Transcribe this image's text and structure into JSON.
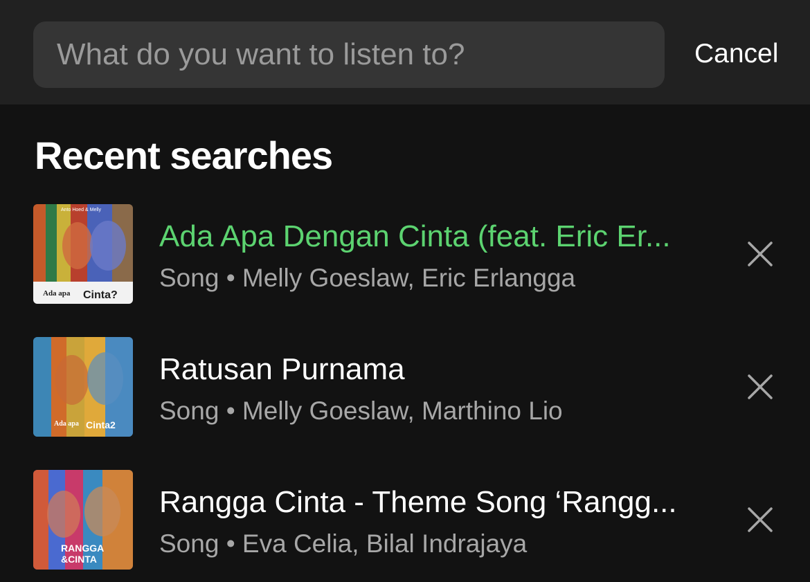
{
  "search": {
    "placeholder": "What do you want to listen to?",
    "value": "",
    "cancel_label": "Cancel"
  },
  "recent": {
    "heading": "Recent searches",
    "items": [
      {
        "title": "Ada Apa Dengan Cinta (feat. Eric Er...",
        "subtitle": "Song • Melly Goeslaw, Eric Erlangga",
        "active": true,
        "artwork_text": "Ada apa dengan Cinta?",
        "remove_icon": "close-icon"
      },
      {
        "title": "Ratusan Purnama",
        "subtitle": "Song • Melly Goeslaw, Marthino Lio",
        "active": false,
        "artwork_text": "Ada apa dengan Cinta 2",
        "remove_icon": "close-icon"
      },
      {
        "title": "Rangga Cinta - Theme Song ‘Rangg...",
        "subtitle": "Song • Eva Celia, Bilal Indrajaya",
        "active": false,
        "artwork_text": "RANGGA & CINTA",
        "remove_icon": "close-icon"
      }
    ]
  },
  "colors": {
    "background": "#121212",
    "topbar": "#212121",
    "search_box": "#353535",
    "accent_green": "#5cd370",
    "secondary_text": "#a7a7a7"
  }
}
